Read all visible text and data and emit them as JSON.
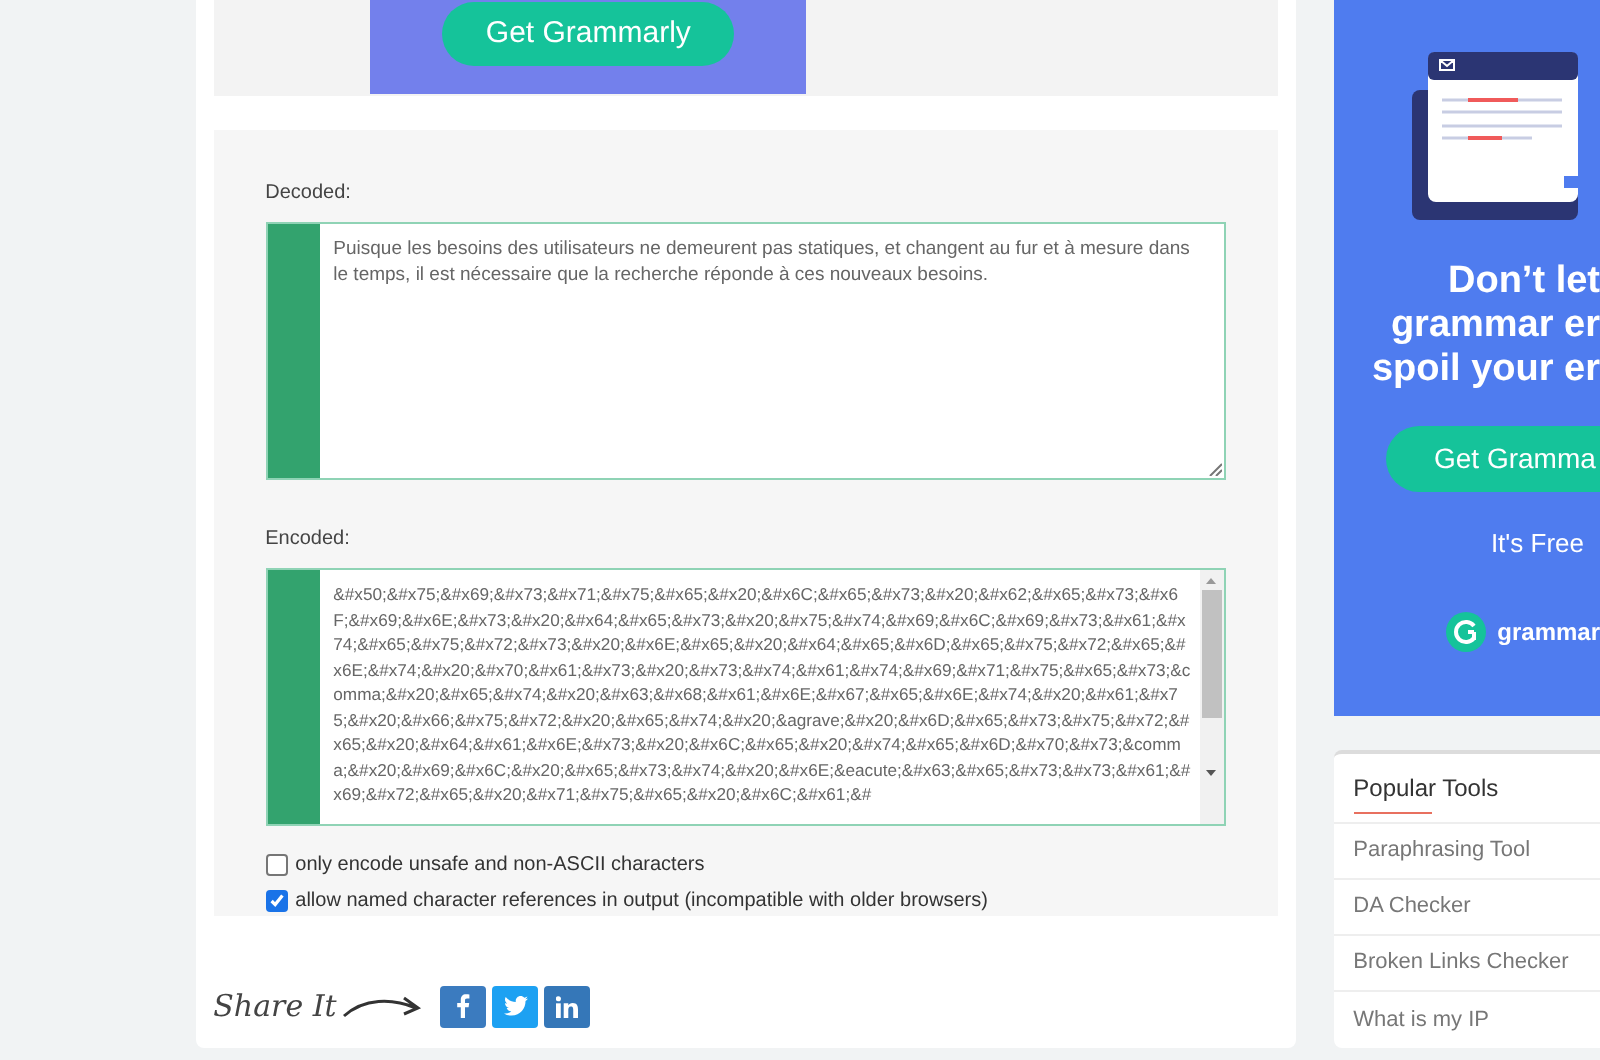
{
  "top_ad": {
    "button": "Get Grammarly"
  },
  "decoder": {
    "decoded_label": "Decoded:",
    "decoded_value": "Puisque les besoins des utilisateurs ne demeurent pas statiques, et changent au fur et à mesure dans le temps, il est nécessaire que la recherche réponde à ces nouveaux besoins.",
    "encoded_label": "Encoded:",
    "encoded_value": "&#x50;&#x75;&#x69;&#x73;&#x71;&#x75;&#x65;&#x20;&#x6C;&#x65;&#x73;&#x20;&#x62;&#x65;&#x73;&#x6F;&#x69;&#x6E;&#x73;&#x20;&#x64;&#x65;&#x73;&#x20;&#x75;&#x74;&#x69;&#x6C;&#x69;&#x73;&#x61;&#x74;&#x65;&#x75;&#x72;&#x73;&#x20;&#x6E;&#x65;&#x20;&#x64;&#x65;&#x6D;&#x65;&#x75;&#x72;&#x65;&#x6E;&#x74;&#x20;&#x70;&#x61;&#x73;&#x20;&#x73;&#x74;&#x61;&#x74;&#x69;&#x71;&#x75;&#x65;&#x73;&comma;&#x20;&#x65;&#x74;&#x20;&#x63;&#x68;&#x61;&#x6E;&#x67;&#x65;&#x6E;&#x74;&#x20;&#x61;&#x75;&#x20;&#x66;&#x75;&#x72;&#x20;&#x65;&#x74;&#x20;&agrave;&#x20;&#x6D;&#x65;&#x73;&#x75;&#x72;&#x65;&#x20;&#x64;&#x61;&#x6E;&#x73;&#x20;&#x6C;&#x65;&#x20;&#x74;&#x65;&#x6D;&#x70;&#x73;&comma;&#x20;&#x69;&#x6C;&#x20;&#x65;&#x73;&#x74;&#x20;&#x6E;&eacute;&#x63;&#x65;&#x73;&#x73;&#x61;&#x69;&#x72;&#x65;&#x20;&#x71;&#x75;&#x65;&#x20;&#x6C;&#x61;&#",
    "options": [
      {
        "label": "only encode unsafe and non-ASCII characters",
        "checked": false
      },
      {
        "label": "allow named character references in output (incompatible with older browsers)",
        "checked": true
      }
    ]
  },
  "share": {
    "label": "Share It",
    "buttons": [
      {
        "kind": "facebook",
        "color": "#3b7bbf"
      },
      {
        "kind": "twitter",
        "color": "#1da1f2"
      },
      {
        "kind": "linkedin",
        "color": "#3577b8"
      }
    ]
  },
  "side_ad": {
    "headline": [
      "Don’t let",
      "grammar er",
      "spoil your er"
    ],
    "button": "Get Gramma",
    "note": "It's Free",
    "logo": "grammar"
  },
  "popular_tools": {
    "title": "Popular Tools",
    "items": [
      "Paraphrasing Tool",
      "DA Checker",
      "Broken Links Checker",
      "What is my IP"
    ]
  }
}
